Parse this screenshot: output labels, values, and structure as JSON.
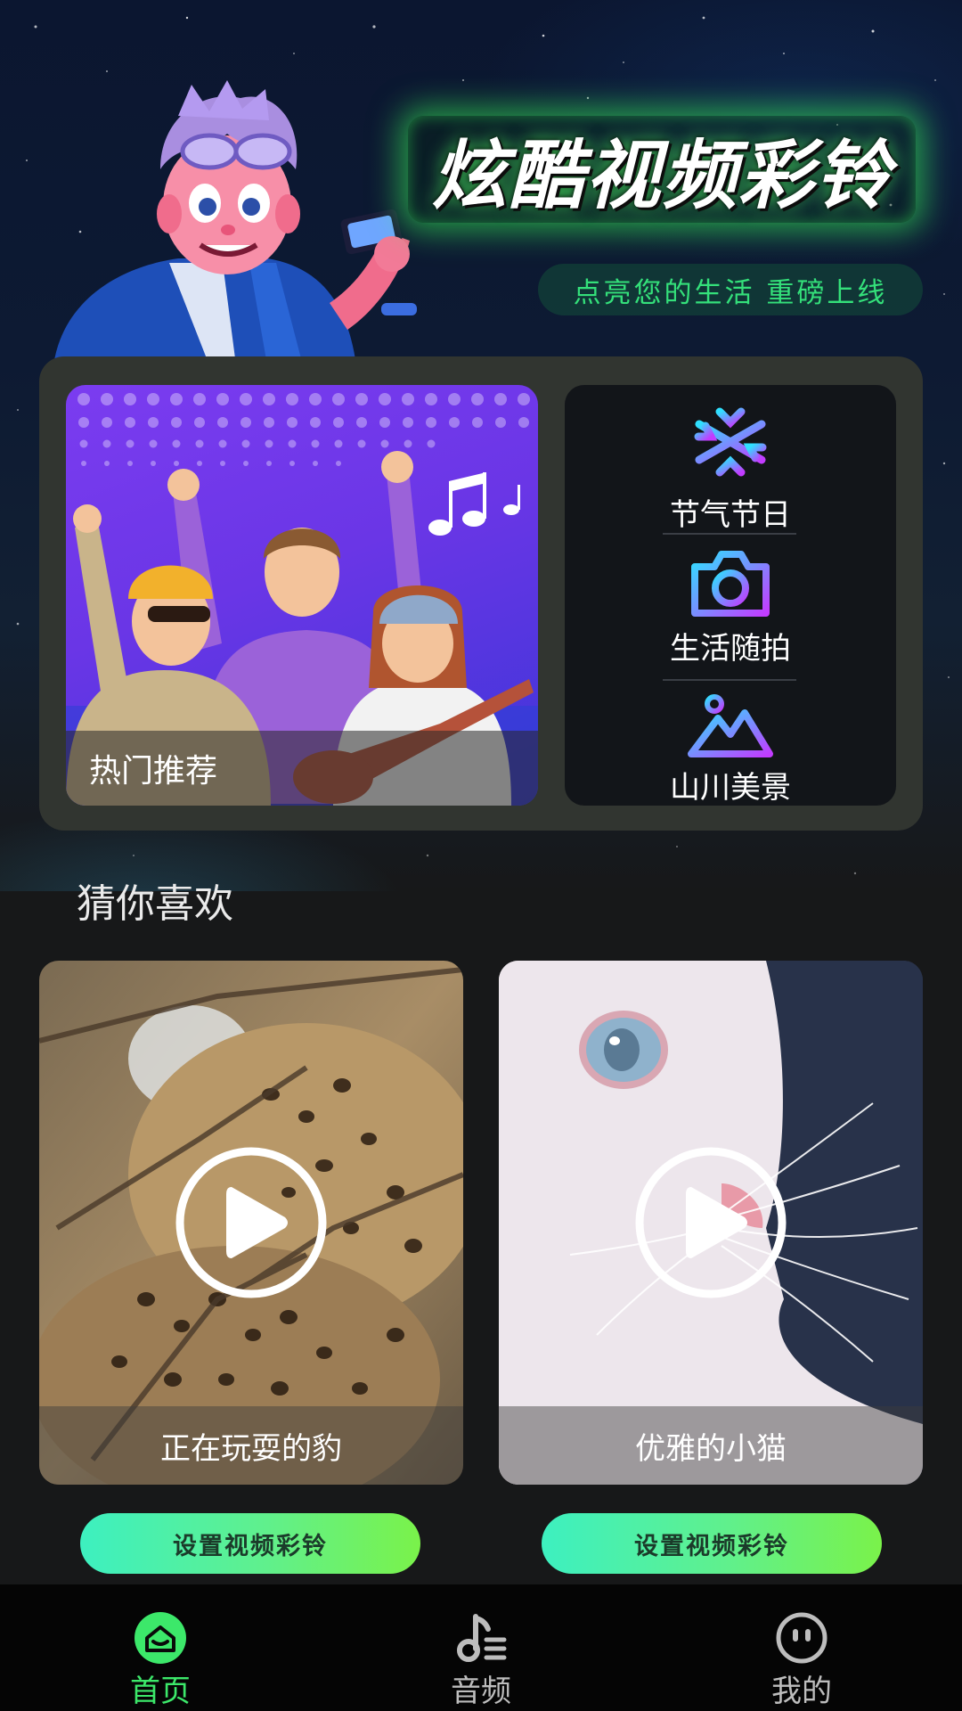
{
  "hero": {
    "title": "炫酷视频彩铃",
    "subtitle": "点亮您的生活 重磅上线"
  },
  "categories": {
    "featured_label": "热门推荐",
    "items": [
      {
        "label": "节气节日",
        "icon": "snowflake-icon"
      },
      {
        "label": "生活随拍",
        "icon": "camera-icon"
      },
      {
        "label": "山川美景",
        "icon": "mountain-icon"
      }
    ]
  },
  "recommend": {
    "title": "猜你喜欢",
    "videos": [
      {
        "caption": "正在玩耍的豹",
        "button": "设置视频彩铃"
      },
      {
        "caption": "优雅的小猫",
        "button": "设置视频彩铃"
      }
    ]
  },
  "nav": {
    "items": [
      {
        "label": "首页",
        "icon": "home-icon",
        "active": true
      },
      {
        "label": "音频",
        "icon": "music-note-icon",
        "active": false
      },
      {
        "label": "我的",
        "icon": "profile-face-icon",
        "active": false
      }
    ]
  },
  "colors": {
    "accent": "#3ce86a",
    "background": "#171819",
    "nav_inactive": "#bdbdbd"
  }
}
